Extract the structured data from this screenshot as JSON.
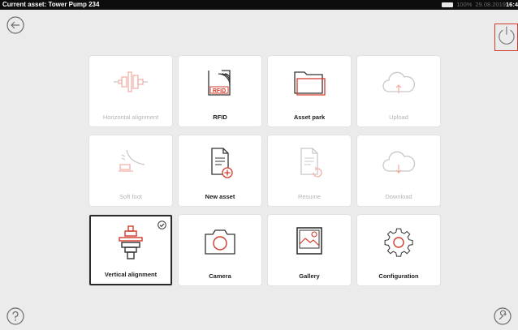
{
  "status": {
    "title": "Current asset: Tower Pump 234",
    "battery": "100%",
    "date": "29.08.2019",
    "time": "16:4"
  },
  "tiles": [
    {
      "label": "Horizontal alignment",
      "enabled": false,
      "icon": "horizontal-alignment-icon"
    },
    {
      "label": "RFID",
      "enabled": true,
      "icon": "rfid-icon",
      "icon_text": "RFID"
    },
    {
      "label": "Asset park",
      "enabled": true,
      "icon": "folder-icon"
    },
    {
      "label": "Upload",
      "enabled": false,
      "icon": "cloud-upload-icon"
    },
    {
      "label": "Soft foot",
      "enabled": false,
      "icon": "soft-foot-icon"
    },
    {
      "label": "New asset",
      "enabled": true,
      "icon": "new-document-icon"
    },
    {
      "label": "Resume",
      "enabled": false,
      "icon": "resume-document-icon"
    },
    {
      "label": "Download",
      "enabled": false,
      "icon": "cloud-download-icon"
    },
    {
      "label": "Vertical alignment",
      "enabled": true,
      "selected": true,
      "icon": "vertical-alignment-icon"
    },
    {
      "label": "Camera",
      "enabled": true,
      "icon": "camera-icon"
    },
    {
      "label": "Gallery",
      "enabled": true,
      "icon": "gallery-icon"
    },
    {
      "label": "Configuration",
      "enabled": true,
      "icon": "gear-icon"
    }
  ],
  "colors": {
    "accent": "#d23b2d",
    "background": "#ebebeb",
    "disabled": "#c8c8c8"
  }
}
